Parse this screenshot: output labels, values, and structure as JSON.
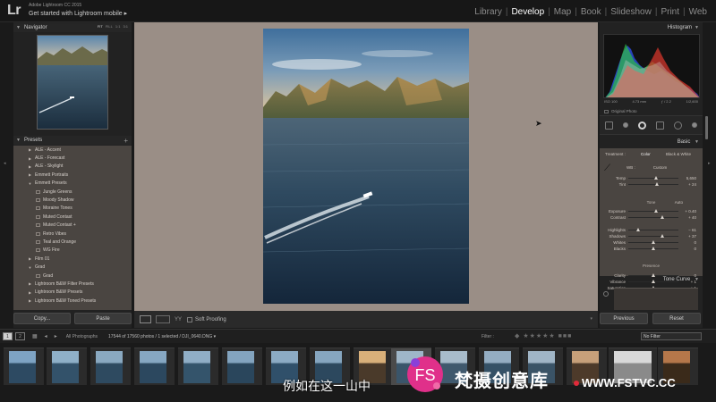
{
  "app": {
    "logo": "Lr",
    "name": "Adobe Lightroom CC 2015",
    "subtitle": "Get started with Lightroom mobile ▸",
    "modules": [
      "Library",
      "Develop",
      "Map",
      "Book",
      "Slideshow",
      "Print",
      "Web"
    ],
    "active_module": "Develop"
  },
  "left": {
    "navigator_title": "Navigator",
    "zoom_levels": [
      "FIT",
      "FILL",
      "1:1",
      "3:1"
    ],
    "presets_title": "Presets",
    "presets_plus": "+",
    "presets": [
      {
        "label": "ALE - Accent",
        "type": "folder",
        "open": false
      },
      {
        "label": "ALE - Forecast",
        "type": "folder",
        "open": false
      },
      {
        "label": "ALE - Skylight",
        "type": "folder",
        "open": false
      },
      {
        "label": "Emmett Portraits",
        "type": "folder",
        "open": false
      },
      {
        "label": "Emmett Presets",
        "type": "folder",
        "open": true
      },
      {
        "label": "Jungle Greens",
        "type": "preset"
      },
      {
        "label": "Moody Shadow",
        "type": "preset"
      },
      {
        "label": "Moraine Tones",
        "type": "preset"
      },
      {
        "label": "Muted Contast",
        "type": "preset"
      },
      {
        "label": "Muted Contast +",
        "type": "preset"
      },
      {
        "label": "Retro Vibes",
        "type": "preset"
      },
      {
        "label": "Teal and Orange",
        "type": "preset"
      },
      {
        "label": "WG Fire",
        "type": "preset"
      },
      {
        "label": "Film 01",
        "type": "folder",
        "open": false
      },
      {
        "label": "Grad",
        "type": "folder",
        "open": true
      },
      {
        "label": "Grad",
        "type": "preset"
      },
      {
        "label": "Lightroom B&W Filter Presets",
        "type": "folder",
        "open": false
      },
      {
        "label": "Lightroom B&W Presets",
        "type": "folder",
        "open": false
      },
      {
        "label": "Lightroom B&W Toned Presets",
        "type": "folder",
        "open": false
      }
    ],
    "copy_label": "Copy...",
    "paste_label": "Paste"
  },
  "toolbar": {
    "yy_label": "YY",
    "soft_proofing": "Soft Proofing"
  },
  "right": {
    "histogram_title": "Histogram",
    "histo_info": {
      "iso": "ISO 100",
      "focal": "4.73 mm",
      "aperture": "ƒ / 2.2",
      "shutter": "1/2,600"
    },
    "original_photo": "Original Photo",
    "basic_title": "Basic",
    "treatment_label": "Treatment :",
    "treatment_color": "Color",
    "treatment_bw": "Black & White",
    "wb_label": "WB :",
    "wb_value": "Custom",
    "tone_label": "Tone",
    "tone_auto": "Auto",
    "presence_label": "Presence",
    "sliders": [
      {
        "label": "Temp",
        "value": "5,650",
        "pos": 0.55
      },
      {
        "label": "Tint",
        "value": "+ 24",
        "pos": 0.58
      },
      {
        "label": "Exposure",
        "value": "+ 0.40",
        "pos": 0.55
      },
      {
        "label": "Contrast",
        "value": "+ 40",
        "pos": 0.68
      },
      {
        "label": "Highlights",
        "value": "− 61",
        "pos": 0.2
      },
      {
        "label": "Shadows",
        "value": "+ 37",
        "pos": 0.68
      },
      {
        "label": "Whites",
        "value": "0",
        "pos": 0.5
      },
      {
        "label": "Blacks",
        "value": "0",
        "pos": 0.5
      },
      {
        "label": "Clarity",
        "value": "0",
        "pos": 0.5
      },
      {
        "label": "Vibrance",
        "value": "+ 1",
        "pos": 0.5
      },
      {
        "label": "Saturation",
        "value": "+ 1",
        "pos": 0.5
      }
    ],
    "tone_curve_title": "Tone Curve",
    "previous_label": "Previous",
    "reset_label": "Reset"
  },
  "filmstrip_bar": {
    "page_1": "1",
    "page_2": "2",
    "source": "All Photographs",
    "count": "17544 of 17560 photos / 1 selected / DJI_0640.DNG ▾",
    "filter_label": "Filter :",
    "filter_value": "No Filter"
  },
  "overlay": {
    "subtitle": "例如在这一山中",
    "watermark_text": "梵摄创意库",
    "watermark_url": "WWW.FSTVC.CC",
    "watermark_logo": "FS"
  },
  "colors": {
    "panel_bg": "#222222",
    "preset_bg": "#4a4541",
    "center_bg": "#9a8e86",
    "active_module": "#ffffff",
    "watermark_pink": "#e0308a"
  }
}
